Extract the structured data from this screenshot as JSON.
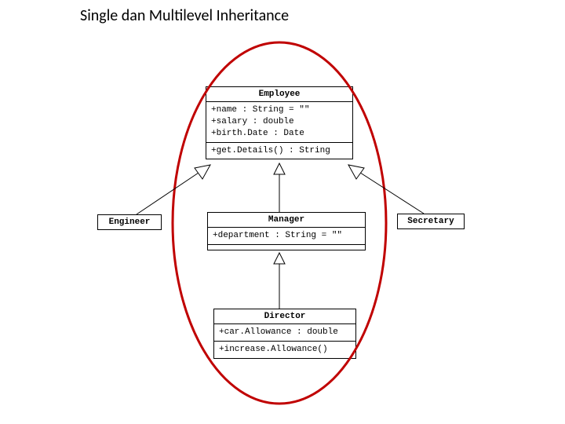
{
  "title": "Single dan Multilevel Inheritance",
  "employee": {
    "name": "Employee",
    "attr1": "+name : String = \"\"",
    "attr2": "+salary : double",
    "attr3": "+birth.Date : Date",
    "op1": "+get.Details() : String"
  },
  "engineer": {
    "name": "Engineer"
  },
  "manager": {
    "name": "Manager",
    "attr1": "+department : String = \"\""
  },
  "secretary": {
    "name": "Secretary"
  },
  "director": {
    "name": "Director",
    "attr1": "+car.Allowance : double",
    "op1": "+increase.Allowance()"
  }
}
